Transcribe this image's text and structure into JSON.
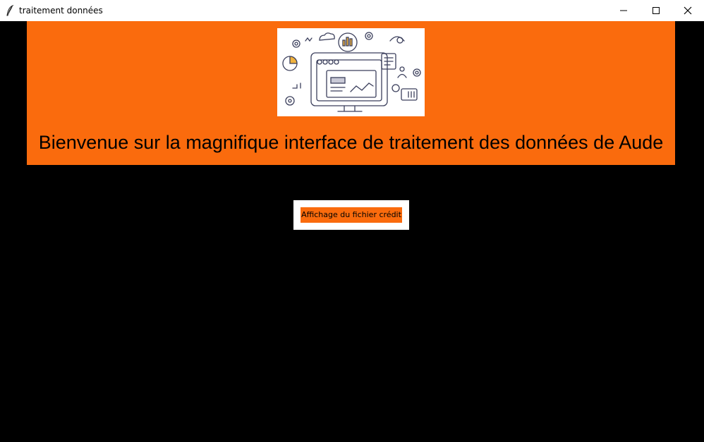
{
  "window": {
    "title": "traitement données",
    "controls": [
      "minimize-icon",
      "maximize-icon",
      "close-icon"
    ]
  },
  "banner": {
    "headline": "Bienvenue sur la magnifique interface de traitement des données de Aude",
    "illustration": "data-dashboard-doodle",
    "background": "#fa6b0d"
  },
  "actions": {
    "credit_file_label": "Affichage du fichier crédit"
  },
  "colors": {
    "accent": "#fa6b0d",
    "background": "#000000",
    "titlebar": "#ffffff"
  }
}
